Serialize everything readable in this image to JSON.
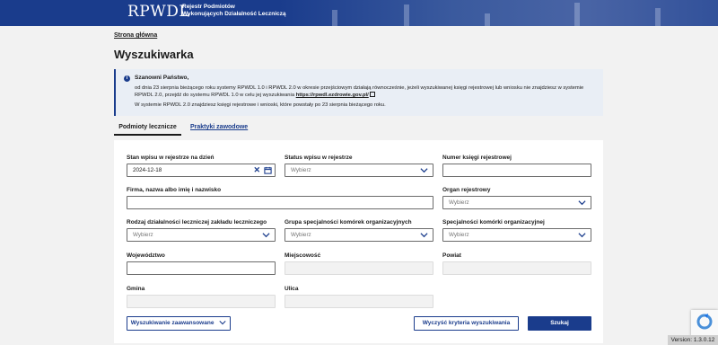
{
  "header": {
    "logo": "RPWDL",
    "subtitle_line1": "Rejestr Podmiotów",
    "subtitle_line2": "Wykonujących Działalność Leczniczą"
  },
  "breadcrumb": "Strona główna",
  "page_title": "Wyszukiwarka",
  "info": {
    "title": "Szanowni Państwo,",
    "para1": "od dnia 23 sierpnia bieżącego roku systemy RPWDL 1.0 i RPWDL 2.0 w okresie przejściowym działają równocześnie, jeżeli wyszukiwanej księgi rejestrowej lub wniosku nie znajdziesz w systemie RPWDL 2.0, przejdź do systemu RPWDL 1.0 w celu jej wyszukiwania",
    "link": "https://rpwdl.ezdrowie.gov.pl/",
    "para2": "W systemie RPWDL 2.0 znajdziesz księgi rejestrowe i wnioski, które powstały po 23 sierpnia bieżącego roku."
  },
  "tabs": [
    {
      "label": "Podmioty lecznicze",
      "active": true
    },
    {
      "label": "Praktyki zawodowe",
      "active": false
    }
  ],
  "form": {
    "stan_label": "Stan wpisu w rejestrze na dzień",
    "stan_value": "2024-12-18",
    "status_label": "Status wpisu w rejestrze",
    "status_placeholder": "Wybierz",
    "numer_label": "Numer księgi rejestrowej",
    "firma_label": "Firma, nazwa albo imię i nazwisko",
    "organ_label": "Organ rejestrowy",
    "organ_placeholder": "Wybierz",
    "rodzaj_label": "Rodzaj działalności leczniczej zakładu leczniczego",
    "rodzaj_placeholder": "Wybierz",
    "grupa_label": "Grupa specjalności komórek organizacyjnych",
    "grupa_placeholder": "Wybierz",
    "spec_label": "Specjalności komórki organizacyjnej",
    "spec_placeholder": "Wybierz",
    "woj_label": "Województwo",
    "miej_label": "Miejscowość",
    "powiat_label": "Powiat",
    "gmina_label": "Gmina",
    "ulica_label": "Ulica"
  },
  "buttons": {
    "advanced": "Wyszukiwanie zaawansowane",
    "clear": "Wyczyść kryteria wyszukiwania",
    "search": "Szukaj"
  },
  "version": "Version: 1.3.0.12",
  "colors": {
    "brand": "#1a3c8c",
    "background": "#f2f2f2"
  }
}
